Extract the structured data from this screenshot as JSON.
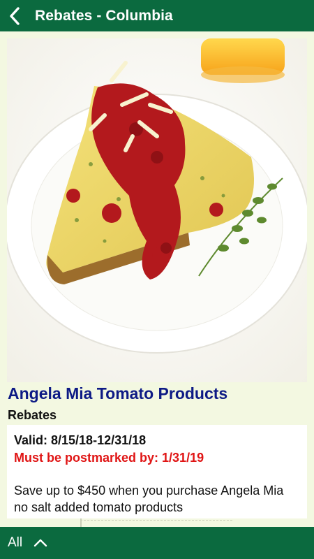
{
  "appbar": {
    "title": "Rebates - Columbia",
    "back_icon": "chevron-left-icon"
  },
  "offer": {
    "image_alt": "frittata with tomato sauce",
    "title": "Angela Mia Tomato Products",
    "category": "Rebates",
    "valid": "Valid: 8/15/18-12/31/18",
    "postmark": "Must be postmarked by: 1/31/19",
    "description": "Save up to $450 when you purchase Angela Mia no salt added tomato products"
  },
  "bottombar": {
    "filter_label": "All",
    "toggle_icon": "chevron-up-icon"
  },
  "colors": {
    "brand_green": "#0b6a3f",
    "title_blue": "#0d1a85",
    "alert_red": "#e01515",
    "background": "#f3f8e1"
  }
}
